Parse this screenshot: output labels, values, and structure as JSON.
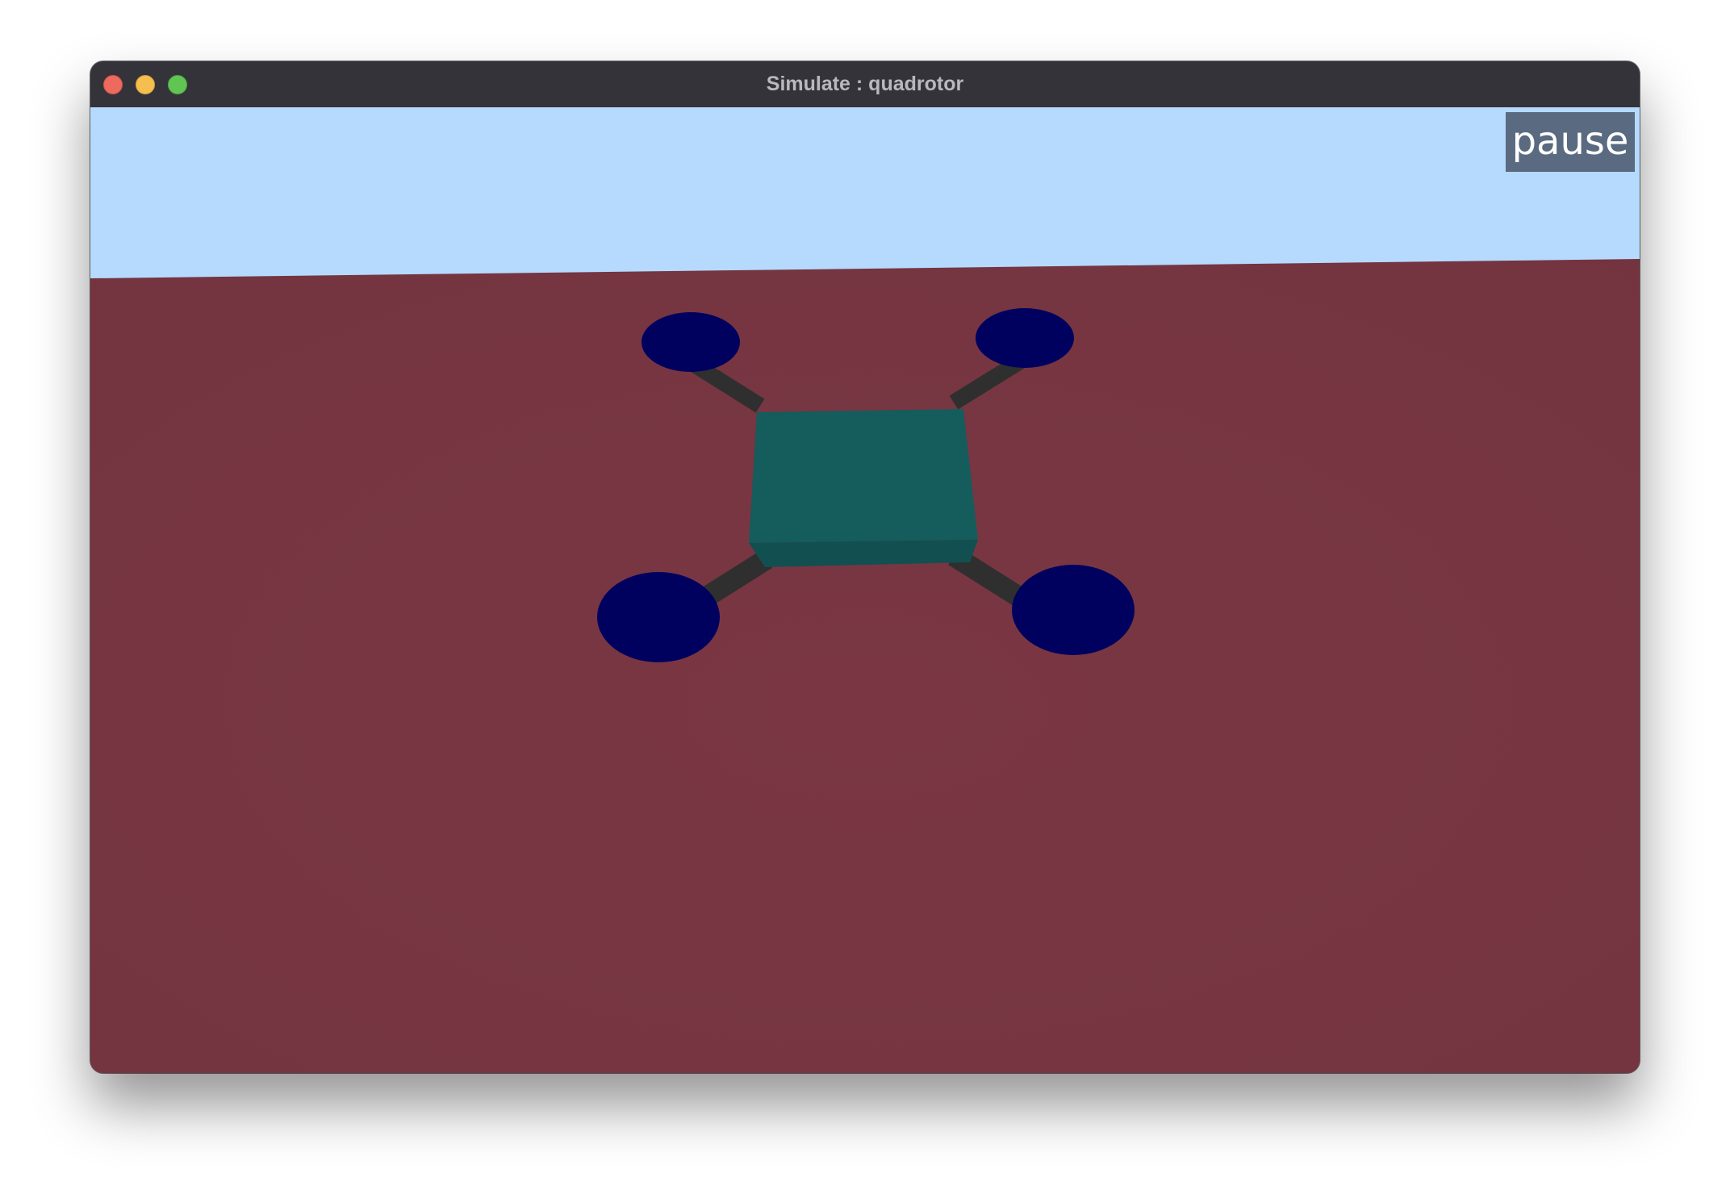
{
  "window": {
    "title": "Simulate : quadrotor",
    "controls": [
      "close",
      "minimize",
      "maximize"
    ]
  },
  "viewport": {
    "pause_label": "pause"
  },
  "colors": {
    "sky": "#b6dafe",
    "floor": "#773541",
    "body": "#155c5c",
    "arms": "#333333",
    "rotors": "#00005f",
    "pause_bg": "#5a6a80"
  }
}
